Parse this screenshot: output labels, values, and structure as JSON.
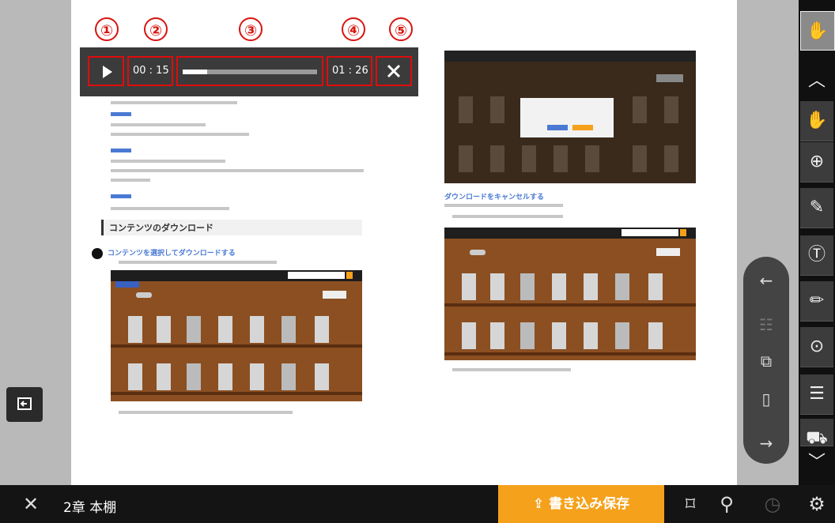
{
  "annotations": [
    "①",
    "②",
    "③",
    "④",
    "⑤"
  ],
  "player": {
    "play_icon": "play-icon",
    "current_time": "00 : 15",
    "total_time": "01 : 26",
    "progress": 0.18,
    "close_icon": "close-icon"
  },
  "document": {
    "section_heading": "コンテンツのダウンロード",
    "step_heading": "コンテンツを選択してダウンロードする",
    "right_heading": "ダウンロードをキャンセルする"
  },
  "toolbar": {
    "items": [
      "hand-icon",
      "chevron-up-icon",
      "hand-icon",
      "zoom-in-icon",
      "pen-icon",
      "text-note-icon",
      "marker-icon",
      "location-pin-icon",
      "memo-icon",
      "car-icon",
      "chevron-down-icon"
    ]
  },
  "nav": {
    "prev_icon": "arrow-left-icon",
    "list_icon": "list-icon",
    "jump_icon": "page-jump-icon",
    "fit_icon": "fit-page-icon",
    "next_icon": "arrow-right-icon"
  },
  "bottom": {
    "close_icon": "close-icon",
    "title": "2章 本棚",
    "save_label": "書き込み保存",
    "bookmark_icon": "bookmark-icon",
    "search_icon": "search-icon",
    "history_icon": "history-icon",
    "settings_icon": "gear-icon"
  },
  "left_panel_icon": "panel-toggle-icon",
  "colors": {
    "accent": "#f5a11b",
    "annotation": "#d8140f",
    "dark": "#141414"
  }
}
